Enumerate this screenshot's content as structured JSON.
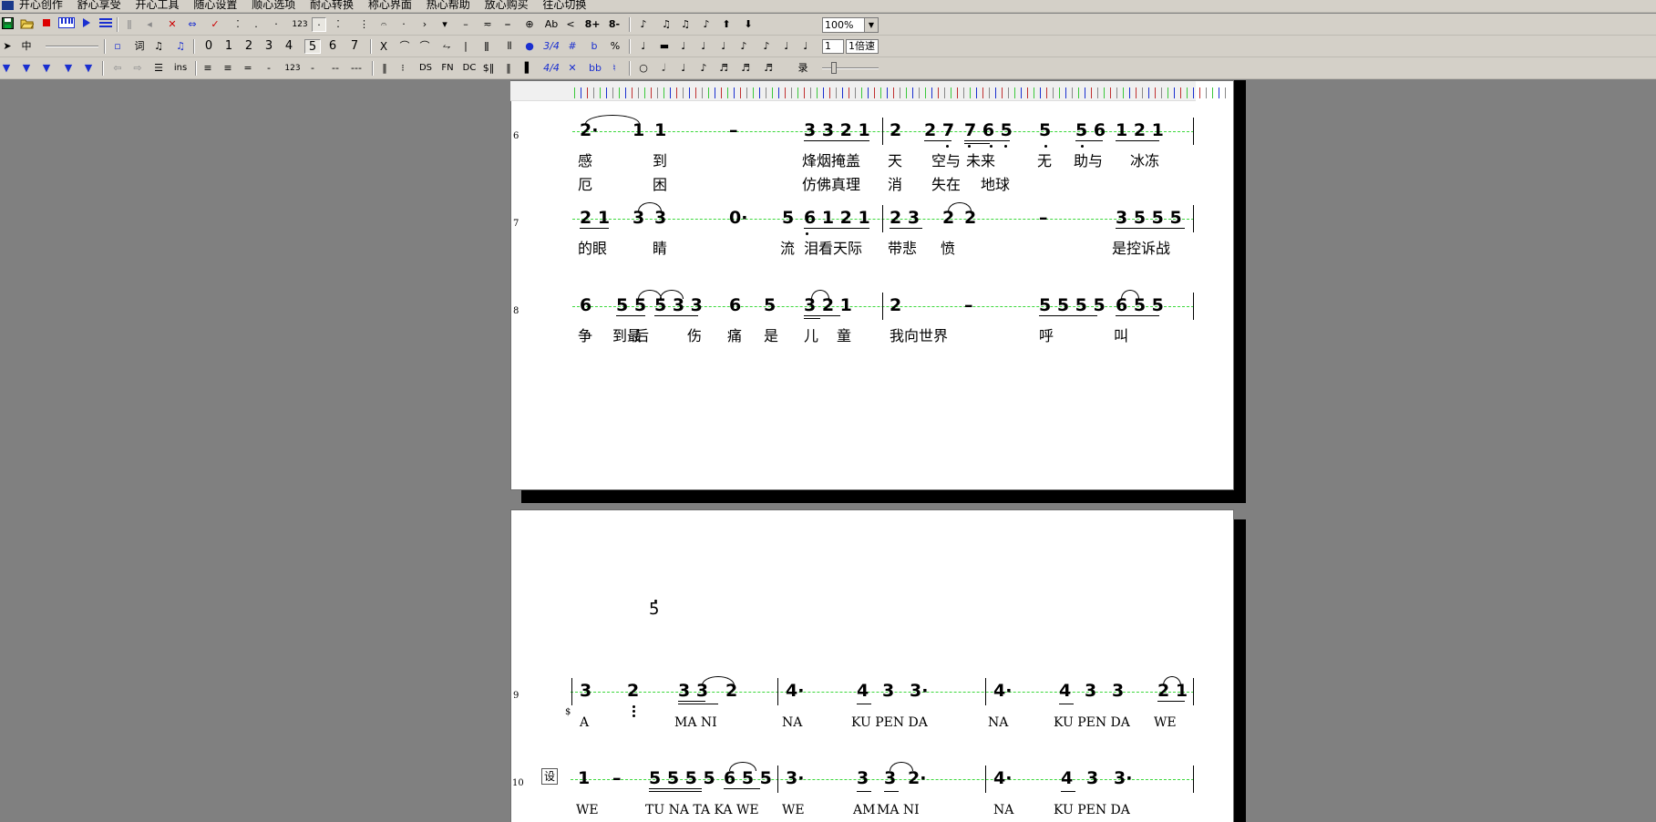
{
  "menu": {
    "items": [
      "开心创作",
      "舒心享受",
      "开心工具",
      "随心设置",
      "顺心选项",
      "耐心转换",
      "称心界面",
      "热心帮助",
      "放心购买",
      "往心切换"
    ]
  },
  "toolbar1": {
    "num_label": "123",
    "ab_label": "Ab",
    "oct_up_label": "8+",
    "oct_down_label": "8-",
    "zoom_value": "100%"
  },
  "toolbar2": {
    "align_label": "中",
    "lyric_label": "词",
    "digits": [
      "0",
      "1",
      "2",
      "3",
      "4",
      "5",
      "6",
      "7"
    ],
    "x_label": "X",
    "time_label": "3/4",
    "sharp_label": "#",
    "flat_label": "b",
    "percent_label": "%",
    "page_field": "1",
    "speed_field": "1倍速"
  },
  "toolbar3": {
    "ins_label": "ins",
    "num_label": "123",
    "dash1_label": "-",
    "dash2_label": "--",
    "dash3_label": "---",
    "ds_label": "DS",
    "fn_label": "FN",
    "dc_label": "DC",
    "time44_label": "4/4",
    "bb_label": "bb",
    "record_label": "录"
  },
  "score": {
    "rows": [
      {
        "num": "6"
      },
      {
        "num": "7"
      },
      {
        "num": "8"
      },
      {
        "num": "9"
      },
      {
        "num": "10"
      }
    ],
    "segno": "$",
    "section_label": "设",
    "upper_note": "5",
    "lyrics": {
      "r6a": [
        "感",
        "到",
        "烽烟掩盖",
        "天",
        "空与",
        "未来",
        "无",
        "助与",
        "冰冻"
      ],
      "r6b": [
        "厄",
        "困",
        "仿佛真理",
        "消",
        "失在",
        "地球"
      ],
      "r7": [
        "的眼",
        "睛",
        "流",
        "泪看天际",
        "带悲",
        "愤",
        "是控诉战"
      ],
      "r8": [
        "争",
        "到最",
        "后",
        "伤",
        "痛",
        "是",
        "儿",
        "童",
        "我向世界",
        "呼",
        "叫"
      ],
      "r9": [
        "A",
        "MA NI",
        "NA",
        "KU PEN DA",
        "NA",
        "KU PEN DA",
        "WE"
      ],
      "r10": [
        "WE",
        "TU NA TA KA WE",
        "WE",
        "AM",
        "MA NI",
        "NA",
        "KU PEN DA"
      ]
    },
    "notes": {
      "r6": [
        "2·",
        "1",
        "1",
        "–",
        "3 3 2 1",
        "2",
        "2 7",
        "7 6 5",
        "5",
        "5 6",
        "1 2 1"
      ],
      "r7": [
        "2 1",
        "3",
        "3",
        "0·",
        "5",
        "6 1 2 1",
        "2 3",
        "2",
        "2",
        "–",
        "3 5 5 5"
      ],
      "r8": [
        "6",
        "5 5",
        "5 3 3",
        "6",
        "5",
        "3 2 1",
        "2",
        "–",
        "5 5 5 5",
        "6 5 5"
      ],
      "r9": [
        "3",
        "2",
        "3 3",
        "2",
        "4·",
        "4",
        "3",
        "3·",
        "4·",
        "4",
        "3",
        "3",
        "2 1"
      ],
      "r10": [
        "1",
        "–",
        "5 5 5 5",
        "6 5 5",
        "3·",
        "3",
        "3",
        "2·",
        "4·",
        "4",
        "3",
        "3·"
      ]
    }
  }
}
